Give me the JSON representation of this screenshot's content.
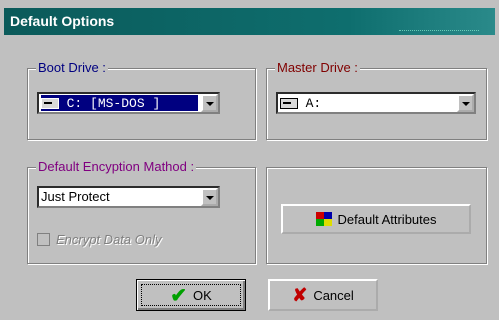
{
  "window": {
    "title": "Default Options"
  },
  "boot_drive": {
    "label": "Boot Drive :",
    "value": "C: [MS-DOS ]"
  },
  "master_drive": {
    "label": "Master Drive :",
    "value": "A:"
  },
  "encryption": {
    "label": "Default Encyption Mathod :",
    "value": "Just Protect"
  },
  "encrypt_data_only": {
    "label": "Encrypt Data Only",
    "checked": false,
    "enabled": false
  },
  "buttons": {
    "default_attributes": "Default Attributes",
    "ok": "OK",
    "cancel": "Cancel"
  },
  "colors": {
    "title_bar": "#0e6e6e",
    "master_drive_label": "#800000",
    "encryption_label": "#800080"
  }
}
